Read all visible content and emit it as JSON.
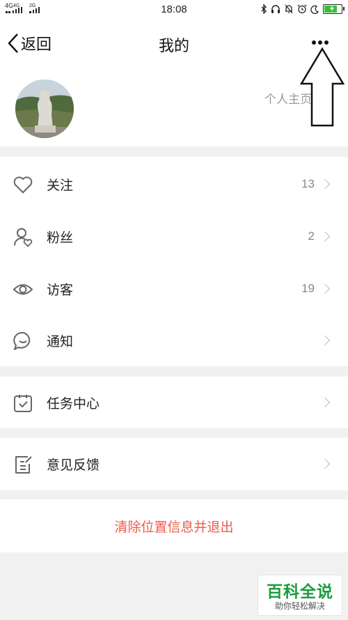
{
  "status_bar": {
    "net_left": "4G",
    "net_left2": "4G",
    "net_right": "2G",
    "time": "18:08",
    "icons": [
      "bluetooth-icon",
      "headset-icon",
      "muted-bell-icon",
      "alarm-icon",
      "moon-icon",
      "battery-icon"
    ],
    "battery_level": 0.7,
    "battery_color": "#3bbf3b"
  },
  "header": {
    "back_label": "返回",
    "title": "我的",
    "more_icon": "more-dots-icon"
  },
  "profile": {
    "homepage_label": "个人主页"
  },
  "menu": {
    "follow": {
      "label": "关注",
      "count": "13",
      "icon": "heart-icon"
    },
    "fans": {
      "label": "粉丝",
      "count": "2",
      "icon": "user-heart-icon"
    },
    "visitors": {
      "label": "访客",
      "count": "19",
      "icon": "eye-icon"
    },
    "notice": {
      "label": "通知",
      "icon": "chat-bubble-icon"
    },
    "tasks": {
      "label": "任务中心",
      "icon": "clipboard-check-icon"
    },
    "feedback": {
      "label": "意见反馈",
      "icon": "edit-note-icon"
    }
  },
  "logout": {
    "label": "清除位置信息并退出",
    "color": "#ef5a4a"
  },
  "watermark": {
    "title": "百科全说",
    "subtitle": "助你轻松解决",
    "color": "#1a9c3c"
  }
}
